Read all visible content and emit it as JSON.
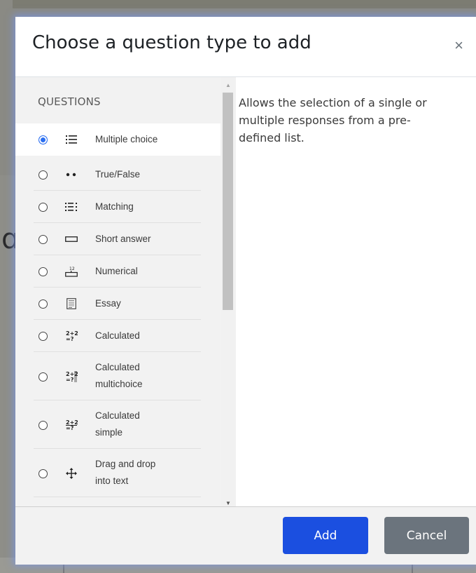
{
  "dialog": {
    "title": "Choose a question type to add",
    "close_symbol": "×",
    "section_label": "QUESTIONS",
    "selected_description": "Allows the selection of a single or multiple responses from a pre-defined list.",
    "options": [
      {
        "label": "Multiple choice",
        "icon": "list-icon",
        "selected": true
      },
      {
        "label": "True/False",
        "icon": "two-dots-icon",
        "selected": false
      },
      {
        "label": "Matching",
        "icon": "matching-list-icon",
        "selected": false
      },
      {
        "label": "Short answer",
        "icon": "text-box-icon",
        "selected": false
      },
      {
        "label": "Numerical",
        "icon": "numerical-icon",
        "selected": false
      },
      {
        "label": "Essay",
        "icon": "essay-icon",
        "selected": false
      },
      {
        "label": "Calculated",
        "icon": "calculated-icon",
        "selected": false
      },
      {
        "label": "Calculated\nmultichoice",
        "icon": "calculated-multichoice-icon",
        "selected": false
      },
      {
        "label": "Calculated\nsimple",
        "icon": "calculated-simple-icon",
        "selected": false
      },
      {
        "label": "Drag and drop\ninto text",
        "icon": "drag-arrows-icon",
        "selected": false
      }
    ],
    "buttons": {
      "add": "Add",
      "cancel": "Cancel"
    },
    "colors": {
      "primary": "#1b4fe0",
      "secondary": "#6b747d",
      "radio_selected": "#2a6ef0"
    }
  }
}
